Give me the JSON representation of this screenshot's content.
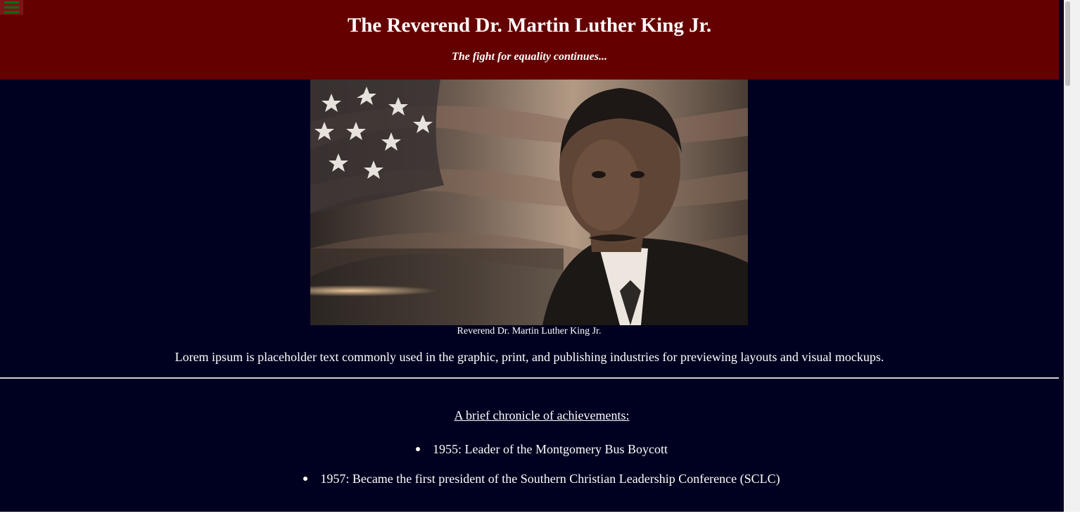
{
  "header": {
    "title": "The Reverend Dr. Martin Luther King Jr.",
    "tagline": "The fight for equality continues...",
    "menu_icon": "hamburger-menu-icon"
  },
  "figure": {
    "caption": "Reverend Dr. Martin Luther King Jr."
  },
  "intro": "Lorem ipsum is placeholder text commonly used in the graphic, print, and publishing industries for previewing layouts and visual mockups.",
  "chronicle": {
    "heading": "A brief chronicle of achievements:",
    "items": [
      "1955: Leader of the Montgomery Bus Boycott",
      "1957: Became the first president of the Southern Christian Leadership Conference (SCLC)"
    ]
  },
  "colors": {
    "header_bg": "#640000",
    "page_bg": "#000020",
    "menu_bars": "#0b6b12",
    "text": "#ffffff"
  }
}
